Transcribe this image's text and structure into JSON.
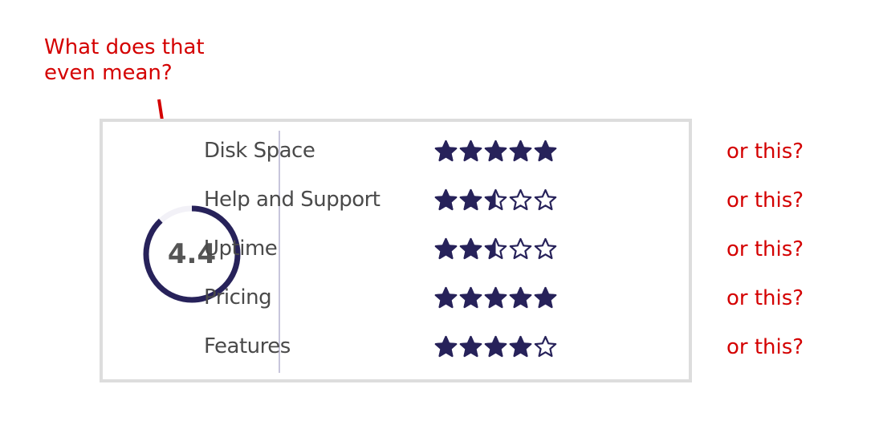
{
  "annotations": {
    "question": "What does that even mean?",
    "or_this_label": "or this?"
  },
  "overall": {
    "score_text": "4.4",
    "score": 4.4,
    "max": 5,
    "fill_fraction": 0.88
  },
  "colors": {
    "accent": "#27225a",
    "annotation": "#d40000",
    "ring_track": "#f2f1f7",
    "card_border": "#dddddd",
    "label_text": "#4a4a4a"
  },
  "categories": [
    {
      "label": "Disk Space",
      "rating": 5,
      "annotation": "or this?"
    },
    {
      "label": "Help and Support",
      "rating": 2.5,
      "annotation": "or this?"
    },
    {
      "label": "Uptime",
      "rating": 2.5,
      "annotation": "or this?"
    },
    {
      "label": "Pricing",
      "rating": 5,
      "annotation": "or this?"
    },
    {
      "label": "Features",
      "rating": 4,
      "annotation": "or this?"
    }
  ]
}
